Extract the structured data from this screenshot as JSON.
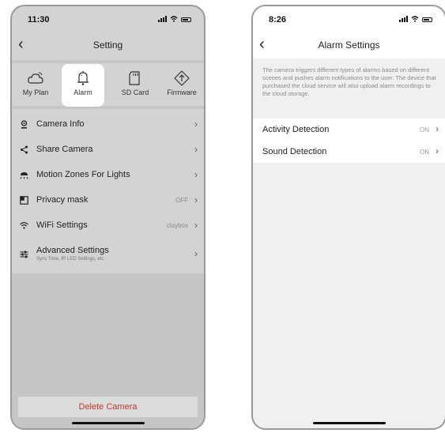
{
  "left_screen": {
    "status": {
      "time": "11:30"
    },
    "nav": {
      "title": "Setting"
    },
    "tabs": [
      {
        "label": "My Plan",
        "icon": "cloud-icon",
        "active": false
      },
      {
        "label": "Alarm",
        "icon": "bell-icon",
        "active": true
      },
      {
        "label": "SD Card",
        "icon": "sd-card-icon",
        "active": false
      },
      {
        "label": "Firmware",
        "icon": "firmware-upgrade-icon",
        "active": false
      }
    ],
    "menu": [
      {
        "label": "Camera Info",
        "icon": "camera-icon",
        "value": ""
      },
      {
        "label": "Share Camera",
        "icon": "share-icon",
        "value": ""
      },
      {
        "label": "Motion Zones For Lights",
        "icon": "lamp-icon",
        "value": ""
      },
      {
        "label": "Privacy mask",
        "icon": "mask-icon",
        "value": "OFF"
      },
      {
        "label": "WiFi Settings",
        "icon": "wifi-icon",
        "value": "claybox"
      },
      {
        "label": "Advanced  Settings",
        "sublabel": "Sync Time, IR LED Settings, etc",
        "icon": "sliders-icon",
        "value": ""
      }
    ],
    "delete_label": "Delete Camera"
  },
  "right_screen": {
    "status": {
      "time": "8:26"
    },
    "nav": {
      "title": "Alarm Settings"
    },
    "description": "The camera triggers different types of alarms based on different scenes and pushes alarm notifications to the user. The device that purchased the cloud service will also upload alarm recordings to the cloud storage.",
    "settings": [
      {
        "label": "Activity Detection",
        "value": "ON"
      },
      {
        "label": "Sound Detection",
        "value": "ON"
      }
    ]
  },
  "colors": {
    "left_background": "#d3d3d3",
    "divider": "#c6c6c6",
    "delete_text": "#c0392b",
    "right_background": "#f0f0f0"
  }
}
